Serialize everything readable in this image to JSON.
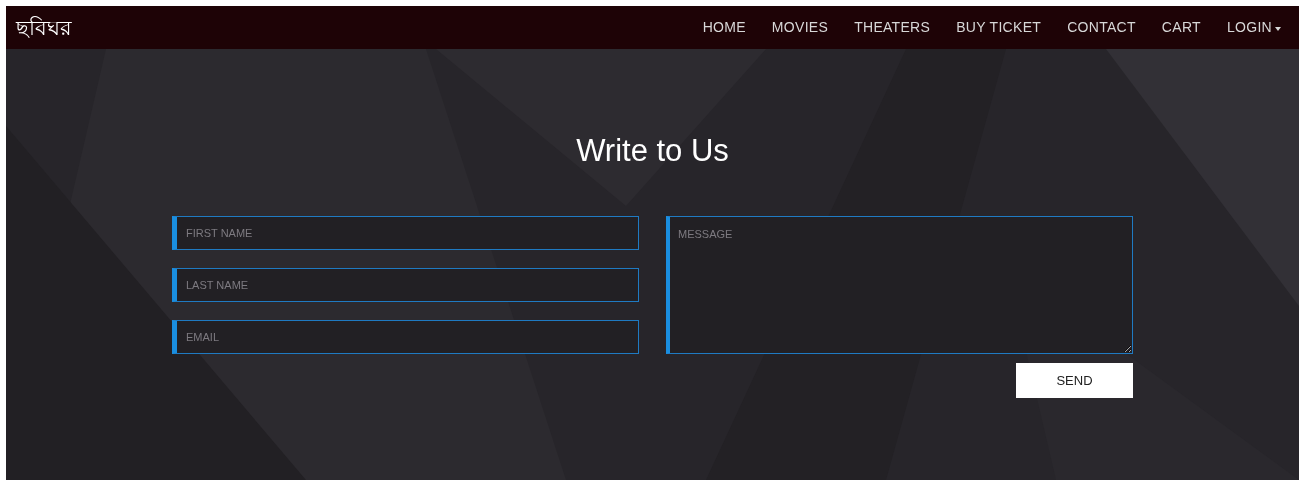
{
  "navbar": {
    "brand": "ছবিঘর",
    "items": [
      {
        "label": "HOME",
        "dropdown": false
      },
      {
        "label": "MOVIES",
        "dropdown": false
      },
      {
        "label": "THEATERS",
        "dropdown": false
      },
      {
        "label": "BUY TICKET",
        "dropdown": false
      },
      {
        "label": "CONTACT",
        "dropdown": false
      },
      {
        "label": "CART",
        "dropdown": false
      },
      {
        "label": "LOGIN",
        "dropdown": true
      }
    ]
  },
  "form": {
    "title": "Write to Us",
    "fields": [
      {
        "placeholder": "FIRST NAME"
      },
      {
        "placeholder": "LAST NAME"
      },
      {
        "placeholder": "EMAIL"
      }
    ],
    "message": {
      "placeholder": "MESSAGE"
    },
    "submit": "SEND"
  }
}
